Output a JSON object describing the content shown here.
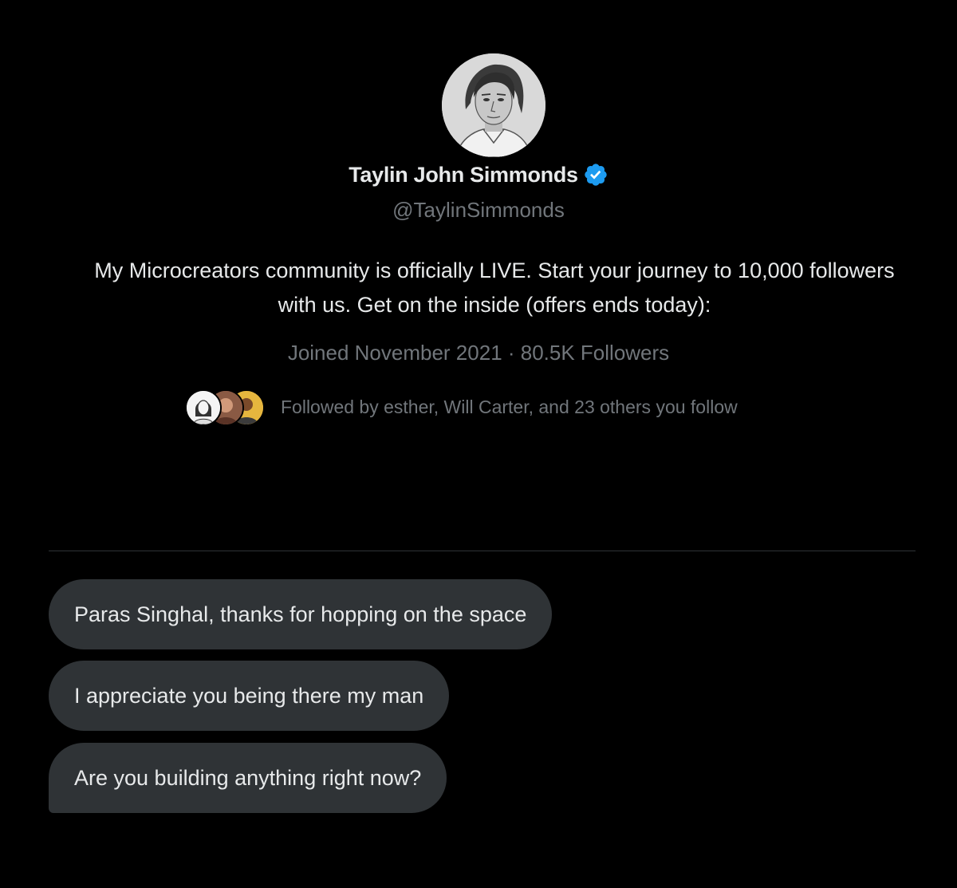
{
  "profile": {
    "name": "Taylin John Simmonds",
    "handle": "@TaylinSimmonds",
    "bio": "My Microcreators community is officially LIVE. Start your journey to 10,000 followers with us. Get on the inside (offers ends today):",
    "meta": "Joined November 2021 · 80.5K Followers",
    "followed_by": "Followed by esther, Will Carter, and 23 others you follow",
    "verified_icon": "verified-badge-icon",
    "verified_color": "#1d9bf0"
  },
  "messages": [
    {
      "text": "Paras Singhal, thanks for hopping on the space"
    },
    {
      "text": "I appreciate you being there my man"
    },
    {
      "text": "Are you building anything right now?"
    }
  ],
  "colors": {
    "background": "#000000",
    "bubble": "#2f3336",
    "primary_text": "#e7e9ea",
    "secondary_text": "#71767b"
  }
}
